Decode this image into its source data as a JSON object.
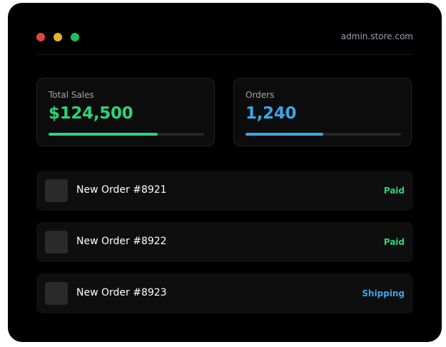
{
  "window": {
    "url": "admin.store.com",
    "controls": [
      {
        "name": "close",
        "color": "#e0443e"
      },
      {
        "name": "minimize",
        "color": "#e2b431"
      },
      {
        "name": "maximize",
        "color": "#1bc35a"
      }
    ]
  },
  "stats": [
    {
      "label": "Total Sales",
      "value": "$124,500",
      "color": "#2ed37a",
      "progress": 0.7
    },
    {
      "label": "Orders",
      "value": "1,240",
      "color": "#3aa6e6",
      "progress": 0.5
    }
  ],
  "orders": [
    {
      "title": "New Order #8921",
      "status": "Paid",
      "status_color": "#2ed37a"
    },
    {
      "title": "New Order #8922",
      "status": "Paid",
      "status_color": "#2ed37a"
    },
    {
      "title": "New Order #8923",
      "status": "Shipping",
      "status_color": "#3aa6e6"
    }
  ]
}
